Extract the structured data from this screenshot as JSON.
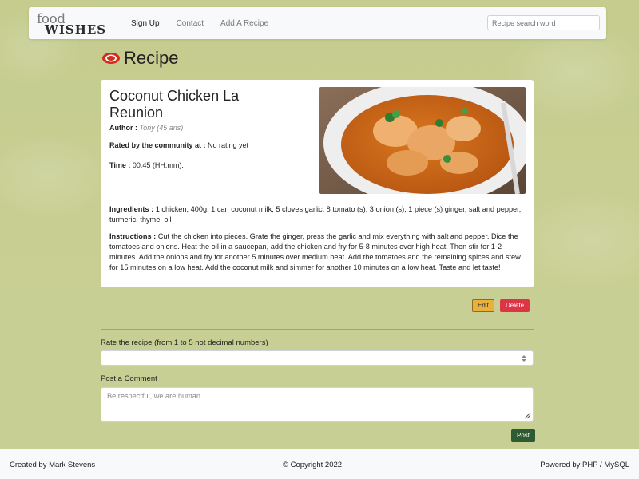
{
  "navbar": {
    "logo_top": "food",
    "logo_bottom": "WISHES",
    "links": [
      "Sign Up",
      "Contact",
      "Add A Recipe"
    ],
    "search_placeholder": "Recipe search word"
  },
  "page": {
    "heading": "Recipe"
  },
  "recipe": {
    "title": "Coconut Chicken La Reunion",
    "author_label": "Author :",
    "author_value": "Tony (45 ans)",
    "rating_label": "Rated by the community at :",
    "rating_value": "No rating yet",
    "time_label": "Time :",
    "time_value": "00:45 (HH:mm).",
    "ingredients_label": "Ingredients :",
    "ingredients_value": "1 chicken, 400g, 1 can coconut milk, 5 cloves garlic, 8 tomato (s), 3 onion (s), 1 piece (s) ginger, salt and pepper, turmeric, thyme, oil",
    "instructions_label": "Instructions :",
    "instructions_value": "Cut the chicken into pieces. Grate the ginger, press the garlic and mix everything with salt and pepper. Dice the tomatoes and onions. Heat the oil in a saucepan, add the chicken and fry for 5-8 minutes over high heat. Then stir for 1-2 minutes. Add the onions and fry for another 5 minutes over medium heat. Add the tomatoes and the remaining spices and stew for 15 minutes on a low heat. Add the coconut milk and simmer for another 10 minutes on a low heat. Taste and let taste!"
  },
  "actions": {
    "edit_label": "Edit",
    "delete_label": "Delete"
  },
  "rating_form": {
    "label": "Rate the recipe (from 1 to 5 not decimal numbers)"
  },
  "comment_form": {
    "label": "Post a Comment",
    "placeholder": "Be respectful, we are human.",
    "submit_label": "Post"
  },
  "footer": {
    "left": "Created by Mark Stevens",
    "center": "© Copyright 2022",
    "right": "Powered by PHP / MySQL"
  },
  "colors": {
    "background": "#c8cf94",
    "edit_button": "#e9b03c",
    "delete_button": "#dc3545",
    "post_button": "#2f5b33",
    "icon_red": "#d62b1f"
  }
}
